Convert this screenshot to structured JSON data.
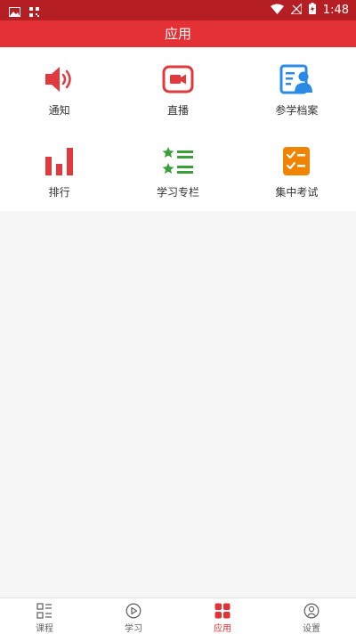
{
  "status_bar": {
    "time": "1:48"
  },
  "header": {
    "title": "应用"
  },
  "apps": [
    {
      "label": "通知",
      "icon": "speaker-icon",
      "color": "#e03a3e"
    },
    {
      "label": "直播",
      "icon": "video-camera-icon",
      "color": "#e03a3e"
    },
    {
      "label": "参学档案",
      "icon": "profile-card-icon",
      "color": "#2a8ae6"
    },
    {
      "label": "排行",
      "icon": "bar-ranking-icon",
      "color": "#e03a3e"
    },
    {
      "label": "学习专栏",
      "icon": "star-list-icon",
      "color": "#3a9e3a"
    },
    {
      "label": "集中考试",
      "icon": "checklist-icon",
      "color": "#f08300"
    }
  ],
  "bottom_nav": [
    {
      "label": "课程",
      "icon": "course-list-icon",
      "active": false
    },
    {
      "label": "学习",
      "icon": "play-circle-icon",
      "active": false
    },
    {
      "label": "应用",
      "icon": "apps-grid-icon",
      "active": true
    },
    {
      "label": "设置",
      "icon": "settings-person-icon",
      "active": false
    }
  ],
  "colors": {
    "status_bar": "#b51f24",
    "app_bar": "#e33135",
    "active_nav": "#e33135",
    "inactive_nav": "#666666"
  }
}
